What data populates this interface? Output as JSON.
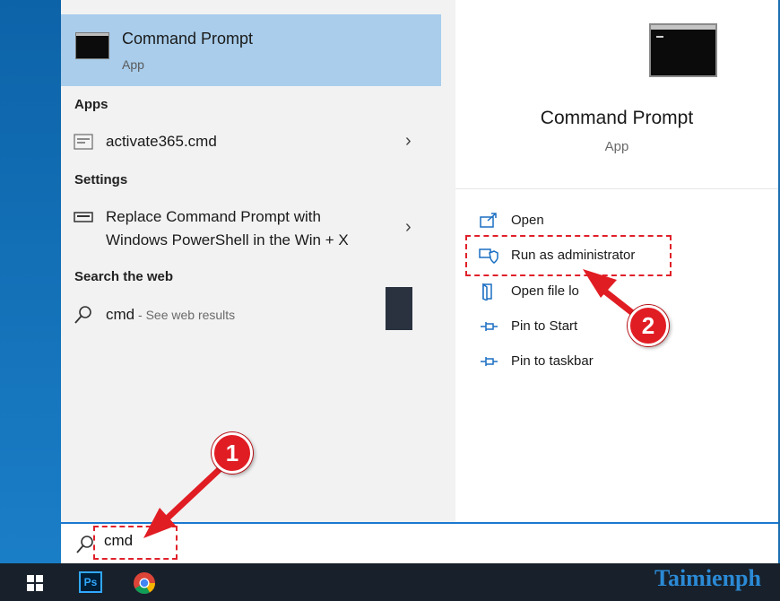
{
  "best_match": {
    "title": "Command Prompt",
    "subtitle": "App"
  },
  "sections": {
    "apps": {
      "heading": "Apps",
      "items": [
        {
          "label": "activate365.cmd",
          "icon": "script-file-icon"
        }
      ]
    },
    "settings": {
      "heading": "Settings",
      "items": [
        {
          "line1": "Replace Command Prompt with",
          "line2": "Windows PowerShell in the Win + X",
          "icon": "keyboard-icon"
        }
      ]
    },
    "web": {
      "heading": "Search the web",
      "items": [
        {
          "query": "cmd",
          "suffix": " - See web results",
          "icon": "search-icon"
        }
      ]
    }
  },
  "detail": {
    "title": "Command Prompt",
    "subtitle": "App",
    "actions": [
      {
        "label": "Open",
        "icon": "open-window-icon"
      },
      {
        "label": "Run as administrator",
        "icon": "shield-icon"
      },
      {
        "label": "Open file lo",
        "icon": "folder-icon"
      },
      {
        "label": "Pin to Start",
        "icon": "pin-icon"
      },
      {
        "label": "Pin to taskbar",
        "icon": "pin-icon"
      }
    ]
  },
  "search": {
    "value": "cmd"
  },
  "taskbar": {
    "ps_label": "Ps",
    "watermark": "Taimienph"
  },
  "markers": {
    "one": "1",
    "two": "2"
  },
  "colors": {
    "selection": "#a9cdeb",
    "accent": "#1a78d0",
    "annotation": "#e11d24",
    "taskbar": "#17202b"
  }
}
